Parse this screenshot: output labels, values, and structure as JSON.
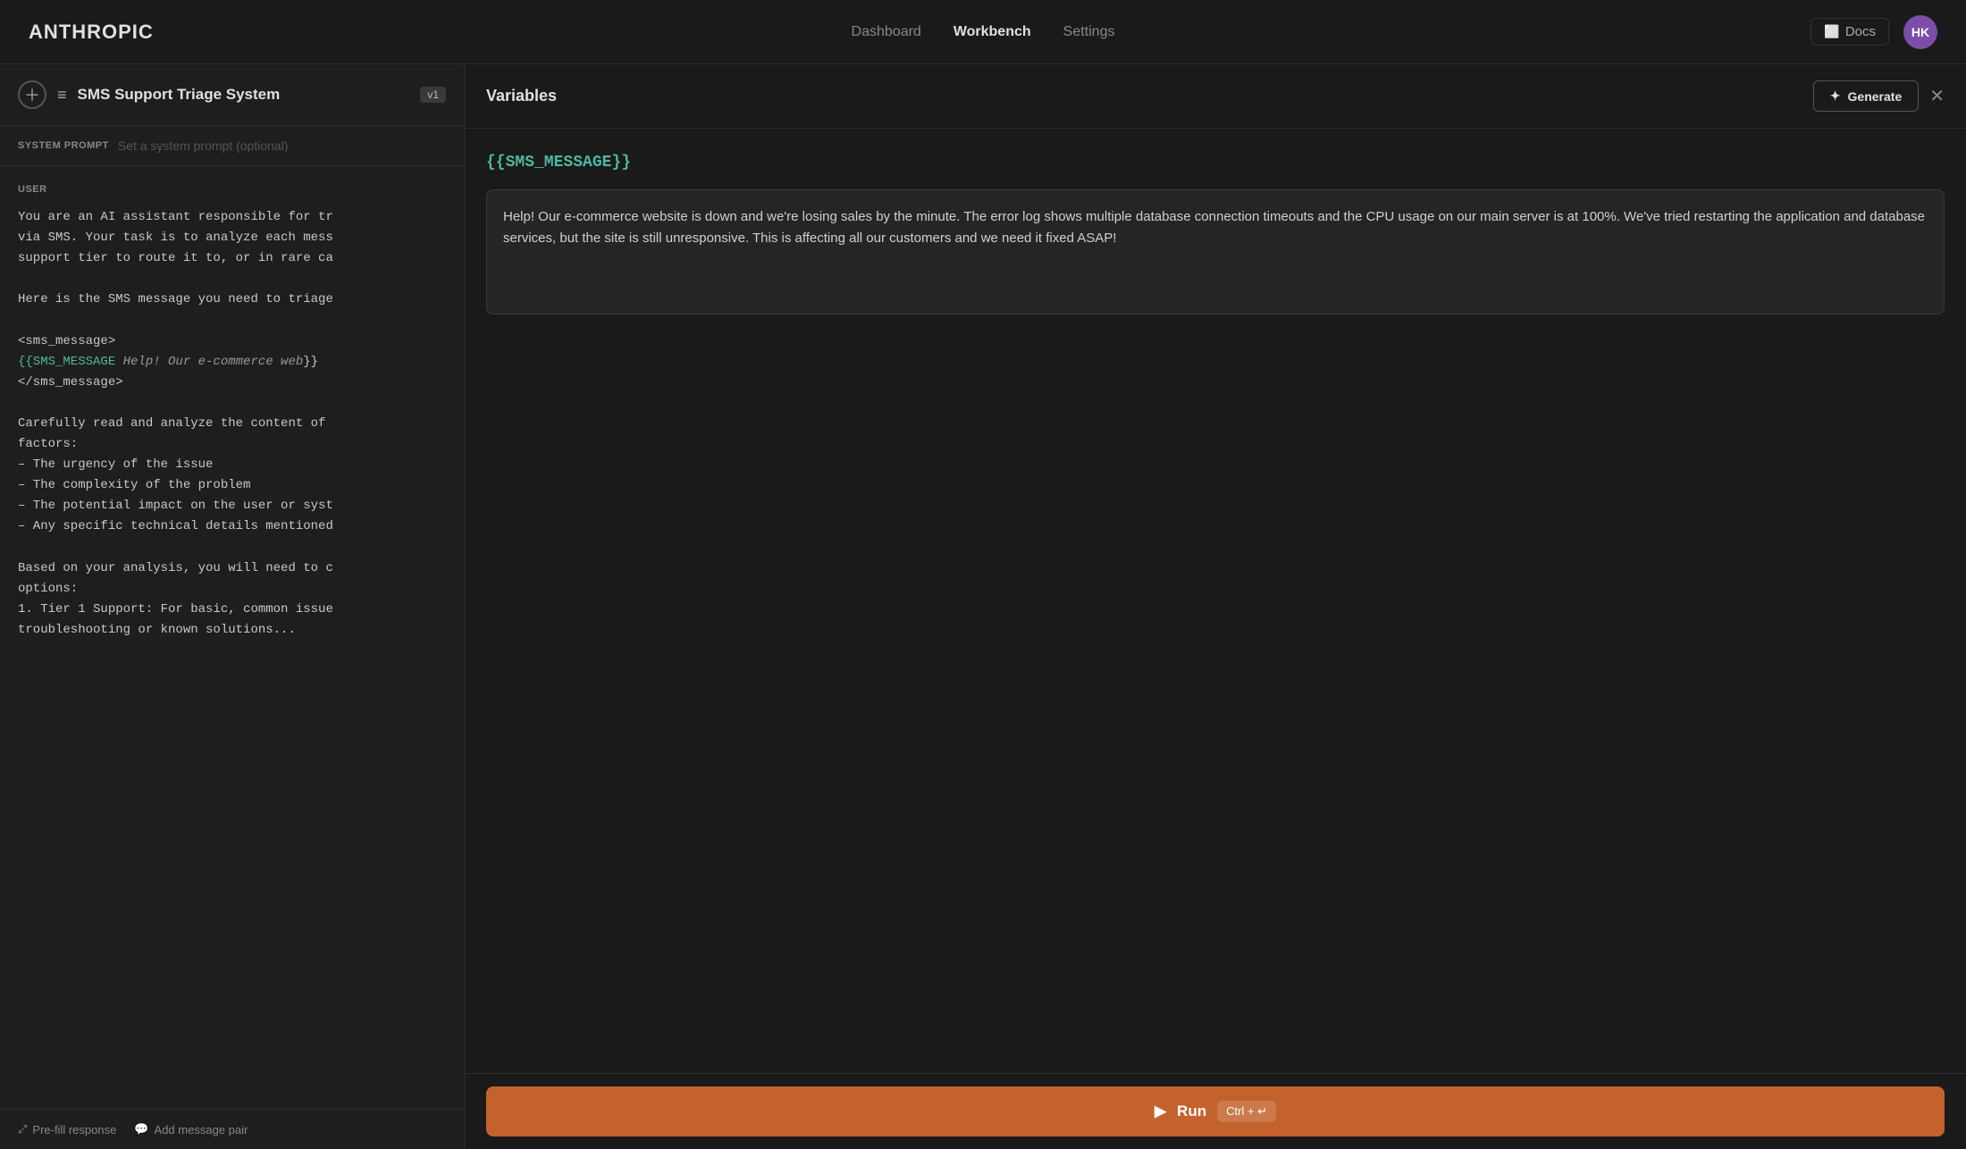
{
  "nav": {
    "logo": "ANTHROPIC",
    "links": [
      {
        "label": "Dashboard",
        "active": false
      },
      {
        "label": "Workbench",
        "active": true
      },
      {
        "label": "Settings",
        "active": false
      }
    ],
    "docs_label": "Docs",
    "avatar_initials": "HK"
  },
  "left_panel": {
    "title": "SMS Support Triage System",
    "version": "v1",
    "system_prompt_label": "SYSTEM PROMPT",
    "system_prompt_placeholder": "Set a system prompt (optional)",
    "user_label": "USER",
    "user_content_lines": [
      "You are an AI assistant responsible for tr",
      "via SMS. Your task is to analyze each mess",
      "support tier to route it to, or in rare ca",
      "",
      "Here is the SMS message you need to triage",
      "",
      "<sms_message>",
      "{{SMS_MESSAGE}} Help! Our e-commerce web}}",
      "</sms_message>",
      "",
      "Carefully read and analyze the content of",
      "factors:",
      "- The urgency of the issue",
      "- The complexity of the problem",
      "- The potential impact on the user or syst",
      "- Any specific technical details mentioned",
      "",
      "Based on your analysis, you will need to c",
      "options:",
      "1. Tier 1 Support: For basic, common issue",
      "troubleshooting or known solutions..."
    ],
    "variable_highlight_text": "{{SMS_MESSAGE",
    "variable_inline_value": " Help! Our e-commerce web",
    "bottom_buttons": [
      {
        "label": "Pre-fill response",
        "icon": "expand-icon"
      },
      {
        "label": "Add message pair",
        "icon": "chat-icon"
      }
    ]
  },
  "right_panel": {
    "title": "Variables",
    "generate_label": "Generate",
    "generate_icon": "sparkle-icon",
    "close_icon": "close-icon",
    "variable_name": "{{SMS_MESSAGE}}",
    "variable_value": "Help! Our e-commerce website is down and we're losing sales by the minute. The error log shows multiple database connection timeouts and the CPU usage on our main server is at 100%. We've tried restarting the application and database services, but the site is still unresponsive. This is affecting all our customers and we need it fixed ASAP!"
  },
  "run_bar": {
    "run_label": "Run",
    "run_icon": "play-icon",
    "shortcut": "Ctrl + ↵"
  }
}
